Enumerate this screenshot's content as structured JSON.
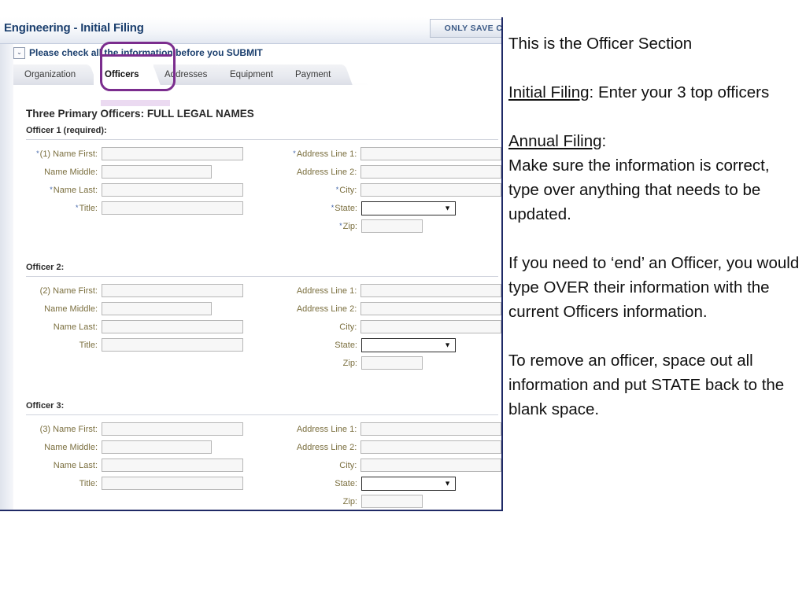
{
  "app": {
    "title": "Engineering - Initial Filing",
    "save_button_label": "ONLY SAVE C",
    "notice": "Please check all the information before you SUBMIT",
    "chevron_glyph": "⌄"
  },
  "tabs": [
    {
      "label": "Organization",
      "active": false
    },
    {
      "label": "Officers",
      "active": true
    },
    {
      "label": "Addresses",
      "active": false
    },
    {
      "label": "Equipment",
      "active": false
    },
    {
      "label": "Payment",
      "active": false
    }
  ],
  "section": {
    "heading": "Three Primary Officers: FULL LEGAL NAMES"
  },
  "officers": [
    {
      "title": "Officer 1 (required):",
      "left": [
        {
          "star": "*",
          "label": "(1) Name First:",
          "value": "",
          "width": "w-long"
        },
        {
          "star": "",
          "label": "Name Middle:",
          "value": "",
          "width": "w-mid"
        },
        {
          "star": "*",
          "label": "Name Last:",
          "value": "",
          "width": "w-long"
        },
        {
          "star": "*",
          "label": "Title:",
          "value": "",
          "width": "w-long"
        }
      ],
      "right": [
        {
          "star": "*",
          "label": "Address Line 1:",
          "value": "",
          "width": "w-long",
          "type": "text"
        },
        {
          "star": "",
          "label": "Address Line 2:",
          "value": "",
          "width": "w-long",
          "type": "text"
        },
        {
          "star": "*",
          "label": "City:",
          "value": "",
          "width": "w-long",
          "type": "text"
        },
        {
          "star": "*",
          "label": "State:",
          "value": "",
          "width": "",
          "type": "select"
        },
        {
          "star": "*",
          "label": "Zip:",
          "value": "",
          "width": "w-short",
          "type": "text"
        }
      ]
    },
    {
      "title": "Officer 2:",
      "left": [
        {
          "star": "",
          "label": "(2) Name First:",
          "value": "",
          "width": "w-long"
        },
        {
          "star": "",
          "label": "Name Middle:",
          "value": "",
          "width": "w-mid"
        },
        {
          "star": "",
          "label": "Name Last:",
          "value": "",
          "width": "w-long"
        },
        {
          "star": "",
          "label": "Title:",
          "value": "",
          "width": "w-long"
        }
      ],
      "right": [
        {
          "star": "",
          "label": "Address Line 1:",
          "value": "",
          "width": "w-long",
          "type": "text"
        },
        {
          "star": "",
          "label": "Address Line 2:",
          "value": "",
          "width": "w-long",
          "type": "text"
        },
        {
          "star": "",
          "label": "City:",
          "value": "",
          "width": "w-long",
          "type": "text"
        },
        {
          "star": "",
          "label": "State:",
          "value": "",
          "width": "",
          "type": "select"
        },
        {
          "star": "",
          "label": "Zip:",
          "value": "",
          "width": "w-short",
          "type": "text"
        }
      ]
    },
    {
      "title": "Officer 3:",
      "left": [
        {
          "star": "",
          "label": "(3) Name First:",
          "value": "",
          "width": "w-long"
        },
        {
          "star": "",
          "label": "Name Middle:",
          "value": "",
          "width": "w-mid"
        },
        {
          "star": "",
          "label": "Name Last:",
          "value": "",
          "width": "w-long"
        },
        {
          "star": "",
          "label": "Title:",
          "value": "",
          "width": "w-long"
        }
      ],
      "right": [
        {
          "star": "",
          "label": "Address Line 1:",
          "value": "",
          "width": "w-long",
          "type": "text"
        },
        {
          "star": "",
          "label": "Address Line 2:",
          "value": "",
          "width": "w-long",
          "type": "text"
        },
        {
          "star": "",
          "label": "City:",
          "value": "",
          "width": "w-long",
          "type": "text"
        },
        {
          "star": "",
          "label": "State:",
          "value": "",
          "width": "",
          "type": "select"
        },
        {
          "star": "",
          "label": "Zip:",
          "value": "",
          "width": "w-short",
          "type": "text"
        }
      ]
    }
  ],
  "notes": {
    "line_1": "This is the Officer Section",
    "initial_filing_label": "Initial Filing",
    "initial_filing_rest": ": Enter your 3 top officers",
    "annual_filing_label": "Annual Filing",
    "annual_filing_rest": ":",
    "annual_filing_body": "Make sure the information is correct, type over anything that needs to be updated.",
    "paragraph_3": "If you need to ‘end’ an Officer, you would type OVER their information with the current Officers information.",
    "paragraph_4": "To remove an officer, space out all information and put STATE back to the blank space."
  },
  "colors": {
    "title_blue": "#1b3f6e",
    "label_olive": "#7b6f3f",
    "annotation_purple": "#7b2d8e",
    "panel_border_navy": "#1f2a66"
  },
  "select_caret_glyph": "▼"
}
